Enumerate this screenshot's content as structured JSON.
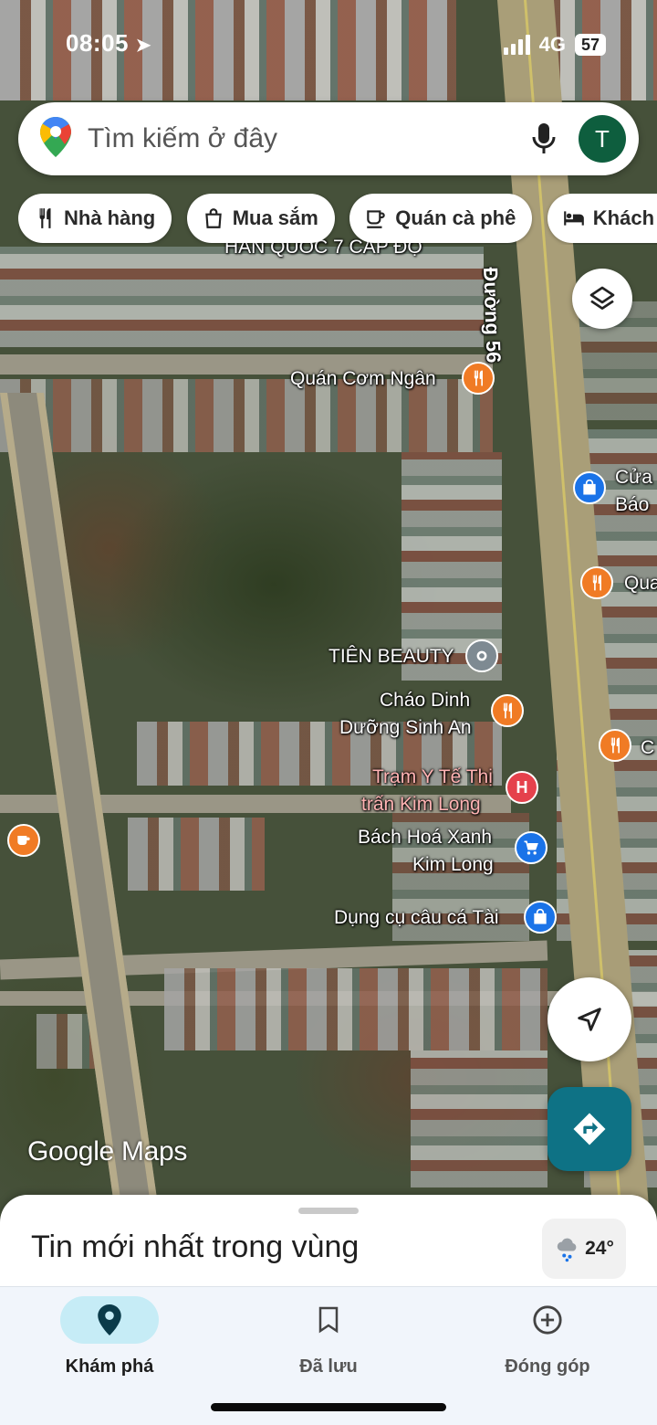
{
  "status_bar": {
    "time": "08:05",
    "network": "4G",
    "battery": "57"
  },
  "search": {
    "placeholder": "Tìm kiếm ở đây",
    "avatar_letter": "T"
  },
  "chips": [
    {
      "label": "Nhà hàng",
      "icon": "fork-knife-icon"
    },
    {
      "label": "Mua sắm",
      "icon": "shopping-bag-icon"
    },
    {
      "label": "Quán cà phê",
      "icon": "coffee-cup-icon"
    },
    {
      "label": "Khách sạn",
      "icon": "bed-icon"
    }
  ],
  "map": {
    "road_name": "Đường 56",
    "places": {
      "top_cut": "HÀN QUỐC 7 CẤP ĐỘ",
      "quan_com": "Quán Cơm Ngân",
      "cua_hang": "Cửa",
      "cua_hang_2": "Báo",
      "quan_right": "Qua",
      "c_right": "C",
      "tien_beauty": "TIÊN BEAUTY",
      "chao_1": "Cháo Dinh",
      "chao_2": "Dưỡng Sinh An",
      "tram_1": "Trạm Y Tế Thị",
      "tram_2": "trấn Kim Long",
      "bhx_1": "Bách Hoá Xanh",
      "bhx_2": "Kim Long",
      "dung_cu": "Dụng cụ câu cá Tài"
    },
    "watermark": "Google Maps"
  },
  "sheet": {
    "title": "Tin mới nhất trong vùng",
    "temperature": "24°"
  },
  "nav": [
    {
      "label": "Khám phá",
      "icon": "location-pin-icon",
      "active": true
    },
    {
      "label": "Đã lưu",
      "icon": "bookmark-icon",
      "active": false
    },
    {
      "label": "Đóng góp",
      "icon": "add-circle-icon",
      "active": false
    }
  ],
  "colors": {
    "accent": "#0e7285",
    "active_tab": "#c6ecf6",
    "avatar": "#0e5e3e"
  }
}
